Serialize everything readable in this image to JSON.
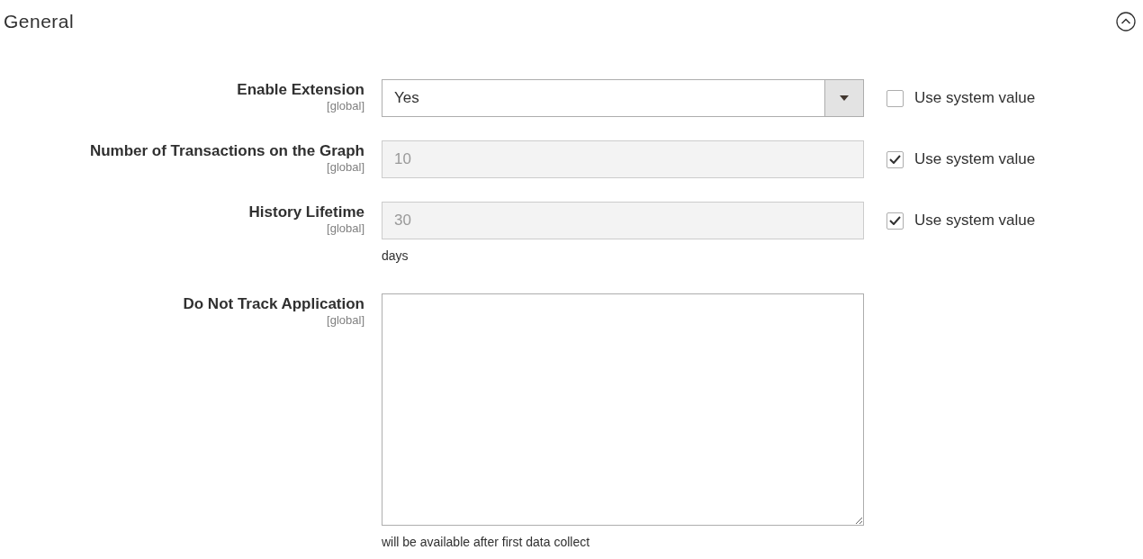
{
  "section": {
    "title": "General",
    "expanded": true
  },
  "fields": [
    {
      "kind": "select",
      "label": "Enable Extension",
      "scope": "[global]",
      "value": "Yes",
      "disabled": false,
      "use_system_value": {
        "label": "Use system value",
        "checked": false
      }
    },
    {
      "kind": "text",
      "label": "Number of Transactions on the Graph",
      "scope": "[global]",
      "value": "10",
      "disabled": true,
      "use_system_value": {
        "label": "Use system value",
        "checked": true
      }
    },
    {
      "kind": "text",
      "label": "History Lifetime",
      "scope": "[global]",
      "value": "30",
      "disabled": true,
      "use_system_value": {
        "label": "Use system value",
        "checked": true
      },
      "note": "days"
    },
    {
      "kind": "textarea",
      "label": "Do Not Track Application",
      "scope": "[global]",
      "disabled": false,
      "note": "will be available after first data collect"
    }
  ]
}
